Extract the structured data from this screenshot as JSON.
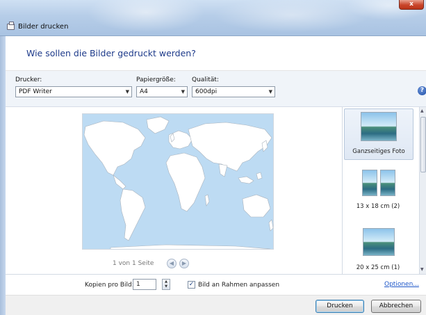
{
  "window": {
    "title": "Bilder drucken",
    "close_label": "x"
  },
  "header": {
    "title": "Wie sollen die Bilder gedruckt werden?"
  },
  "toolbar": {
    "printer": {
      "label": "Drucker:",
      "value": "PDF Writer"
    },
    "paper_size": {
      "label": "Papiergröße:",
      "value": "A4"
    },
    "quality": {
      "label": "Qualität:",
      "value": "600dpi"
    },
    "help_label": "?"
  },
  "preview": {
    "page_status": "1 von 1 Seite",
    "prev_label": "◀",
    "next_label": "▶"
  },
  "layouts": [
    {
      "label": "Ganzseitiges Foto",
      "selected": true
    },
    {
      "label": "13 x 18 cm (2)",
      "selected": false
    },
    {
      "label": "20 x 25 cm (1)",
      "selected": false
    }
  ],
  "options": {
    "copies_label": "Kopien pro Bild:",
    "copies_value": "1",
    "fit_label": "Bild an Rahmen anpassen",
    "fit_checked": true,
    "options_link": "Optionen..."
  },
  "footer": {
    "print_label": "Drucken",
    "cancel_label": "Abbrechen"
  },
  "colors": {
    "header_title": "#1d3a8a",
    "link": "#1d56c8",
    "map_ocean": "#bddbf3",
    "map_land": "#ffffff"
  }
}
